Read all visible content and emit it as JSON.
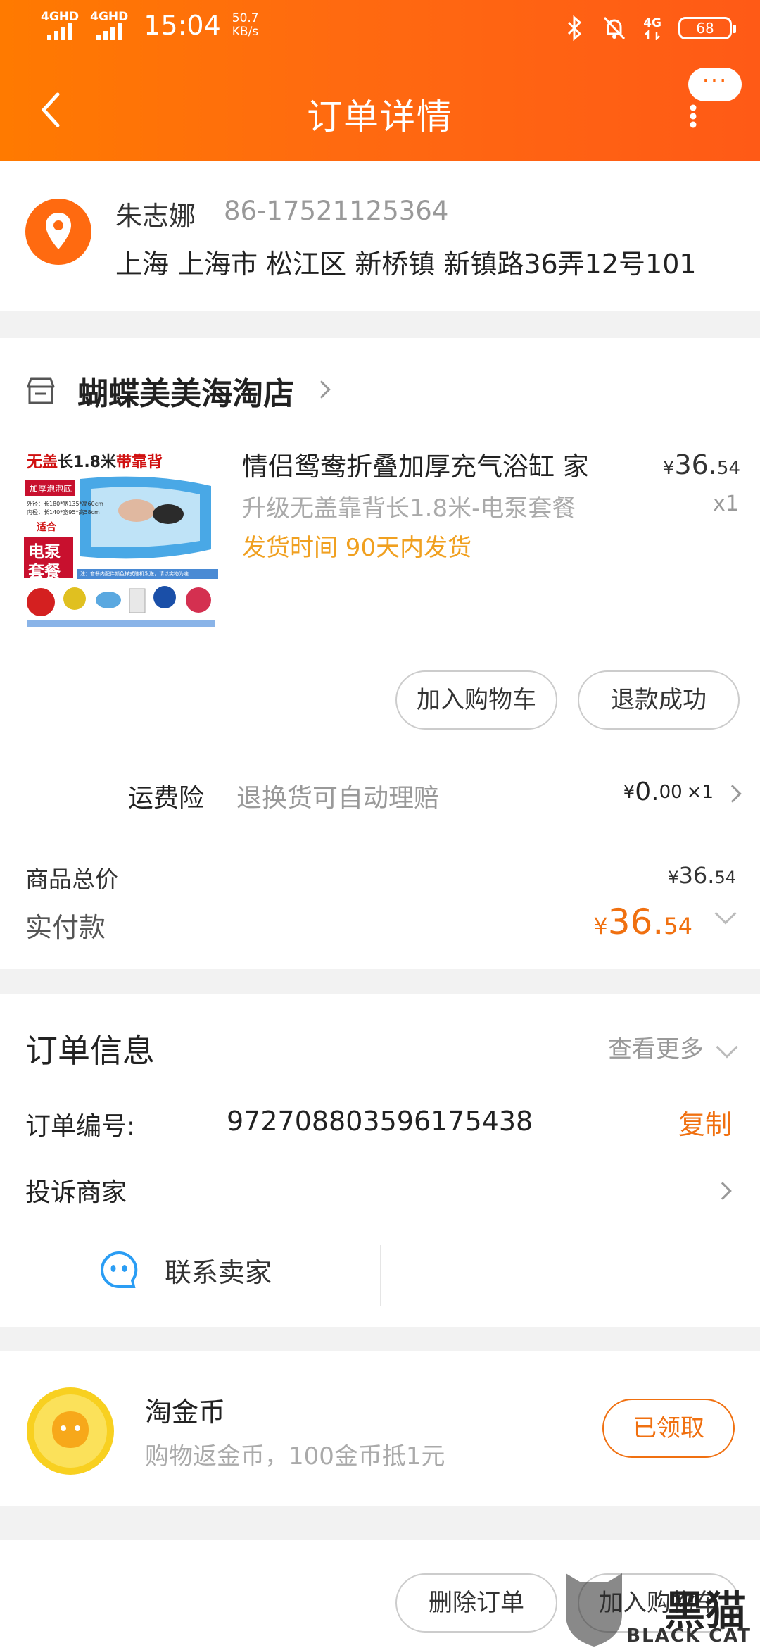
{
  "status_bar": {
    "net1": "4GHD",
    "net2": "4GHD",
    "time": "15:04",
    "speed_value": "50.7",
    "speed_unit": "KB/s",
    "net3": "4G",
    "battery": "68"
  },
  "nav": {
    "title": "订单详情",
    "more_label": "···"
  },
  "address": {
    "name": "朱志娜",
    "phone": "86-17521125364",
    "line": "上海 上海市 松江区 新桥镇 新镇路36弄12号101"
  },
  "shop": {
    "name": "蝴蝶美美海淘店"
  },
  "product": {
    "name": "情侣鸳鸯折叠加厚充气浴缸  家",
    "price_currency": "¥",
    "price_int": "36.",
    "price_dec": "54",
    "sku": "升级无盖靠背长1.8米-电泵套餐",
    "qty": "x1",
    "ship_time": "发货时间 90天内发货",
    "image_text": {
      "headline_1": "无盖",
      "headline_2": "长1.8米",
      "headline_3": "带靠背",
      "tag": "加厚泡泡底",
      "spec1": "外径：长180*宽135*高60cm",
      "spec2": "内径：长140*宽95*高58cm",
      "fit": "适合",
      "pump_1": "电泵",
      "pump_2": "套餐",
      "note": "注：套餐内配件颜色样式随机发送，请以实物为准"
    }
  },
  "buttons": {
    "add_cart": "加入购物车",
    "refund": "退款成功",
    "delete_order": "删除订单",
    "add_cart_bottom": "加入购物车"
  },
  "insurance": {
    "label": "运费险",
    "desc": "退换货可自动理赔",
    "currency": "¥",
    "price_int": "0.",
    "price_dec": "00",
    "qty": "×1"
  },
  "totals": {
    "goods_label": "商品总价",
    "goods_currency": "¥",
    "goods_int": "36.",
    "goods_dec": "54",
    "paid_label": "实付款",
    "paid_currency": "¥",
    "paid_int": "36.",
    "paid_dec": "54"
  },
  "order_info": {
    "title": "订单信息",
    "more": "查看更多",
    "number_label": "订单编号:",
    "number": "972708803596175438",
    "copy": "复制",
    "complain": "投诉商家",
    "contact": "联系卖家"
  },
  "coins": {
    "title": "淘金币",
    "desc": "购物返金币，100金币抵1元",
    "claim": "已领取"
  },
  "watermark": {
    "big": "黑猫",
    "text": "BLACK CAT"
  },
  "colors": {
    "header_orange": "#ff6a10",
    "accent": "#f07010",
    "ship_time": "#f0a020"
  }
}
